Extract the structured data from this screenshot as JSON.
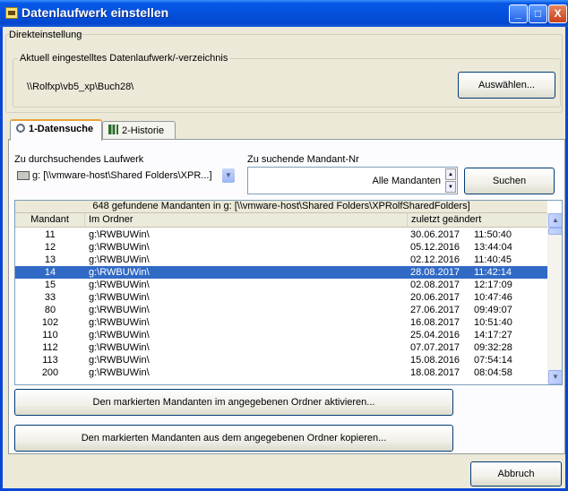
{
  "window": {
    "title": "Datenlaufwerk einstellen",
    "minimize": "_",
    "maximize": "□",
    "close": "X"
  },
  "direct": {
    "group_label": "Direkteinstellung",
    "current_label": "Aktuell eingestelltes Datenlaufwerk/-verzeichnis",
    "current_path": "\\\\Rolfxp\\vb5_xp\\Buch28\\",
    "choose_button": "Auswählen..."
  },
  "tabs": [
    {
      "label": "1-Datensuche",
      "active": true
    },
    {
      "label": "2-Historie",
      "active": false
    }
  ],
  "search": {
    "drive_label": "Zu durchsuchendes Laufwerk",
    "drive_value": "g: [\\\\vmware-host\\Shared Folders\\XPR...]",
    "mandant_label": "Zu suchende Mandant-Nr",
    "mandant_value": "Alle Mandanten",
    "search_button": "Suchen"
  },
  "list": {
    "summary": "648 gefundene Mandanten in g: [\\\\vmware-host\\Shared Folders\\XPRolfSharedFolders]",
    "columns": [
      "Mandant",
      "Im Ordner",
      "zuletzt geändert"
    ],
    "rows": [
      {
        "mandant": "11",
        "folder": "g:\\RWBUWin\\",
        "date": "30.06.2017",
        "time": "11:50:40",
        "selected": false
      },
      {
        "mandant": "12",
        "folder": "g:\\RWBUWin\\",
        "date": "05.12.2016",
        "time": "13:44:04",
        "selected": false
      },
      {
        "mandant": "13",
        "folder": "g:\\RWBUWin\\",
        "date": "02.12.2016",
        "time": "11:40:45",
        "selected": false
      },
      {
        "mandant": "14",
        "folder": "g:\\RWBUWin\\",
        "date": "28.08.2017",
        "time": "11:42:14",
        "selected": true
      },
      {
        "mandant": "15",
        "folder": "g:\\RWBUWin\\",
        "date": "02.08.2017",
        "time": "12:17:09",
        "selected": false
      },
      {
        "mandant": "33",
        "folder": "g:\\RWBUWin\\",
        "date": "20.06.2017",
        "time": "10:47:46",
        "selected": false
      },
      {
        "mandant": "80",
        "folder": "g:\\RWBUWin\\",
        "date": "27.06.2017",
        "time": "09:49:07",
        "selected": false
      },
      {
        "mandant": "102",
        "folder": "g:\\RWBUWin\\",
        "date": "16.08.2017",
        "time": "10:51:40",
        "selected": false
      },
      {
        "mandant": "110",
        "folder": "g:\\RWBUWin\\",
        "date": "25.04.2016",
        "time": "14:17:27",
        "selected": false
      },
      {
        "mandant": "112",
        "folder": "g:\\RWBUWin\\",
        "date": "07.07.2017",
        "time": "09:32:28",
        "selected": false
      },
      {
        "mandant": "113",
        "folder": "g:\\RWBUWin\\",
        "date": "15.08.2016",
        "time": "07:54:14",
        "selected": false
      },
      {
        "mandant": "200",
        "folder": "g:\\RWBUWin\\",
        "date": "18.08.2017",
        "time": "08:04:58",
        "selected": false
      }
    ]
  },
  "actions": {
    "activate": "Den markierten Mandanten im angegebenen Ordner aktivieren...",
    "copy": "Den markierten Mandanten aus dem angegebenen Ordner kopieren...",
    "cancel": "Abbruch"
  },
  "colors": {
    "titlebar": "#0451dc",
    "selection": "#316ac5",
    "face": "#ece9d8"
  }
}
